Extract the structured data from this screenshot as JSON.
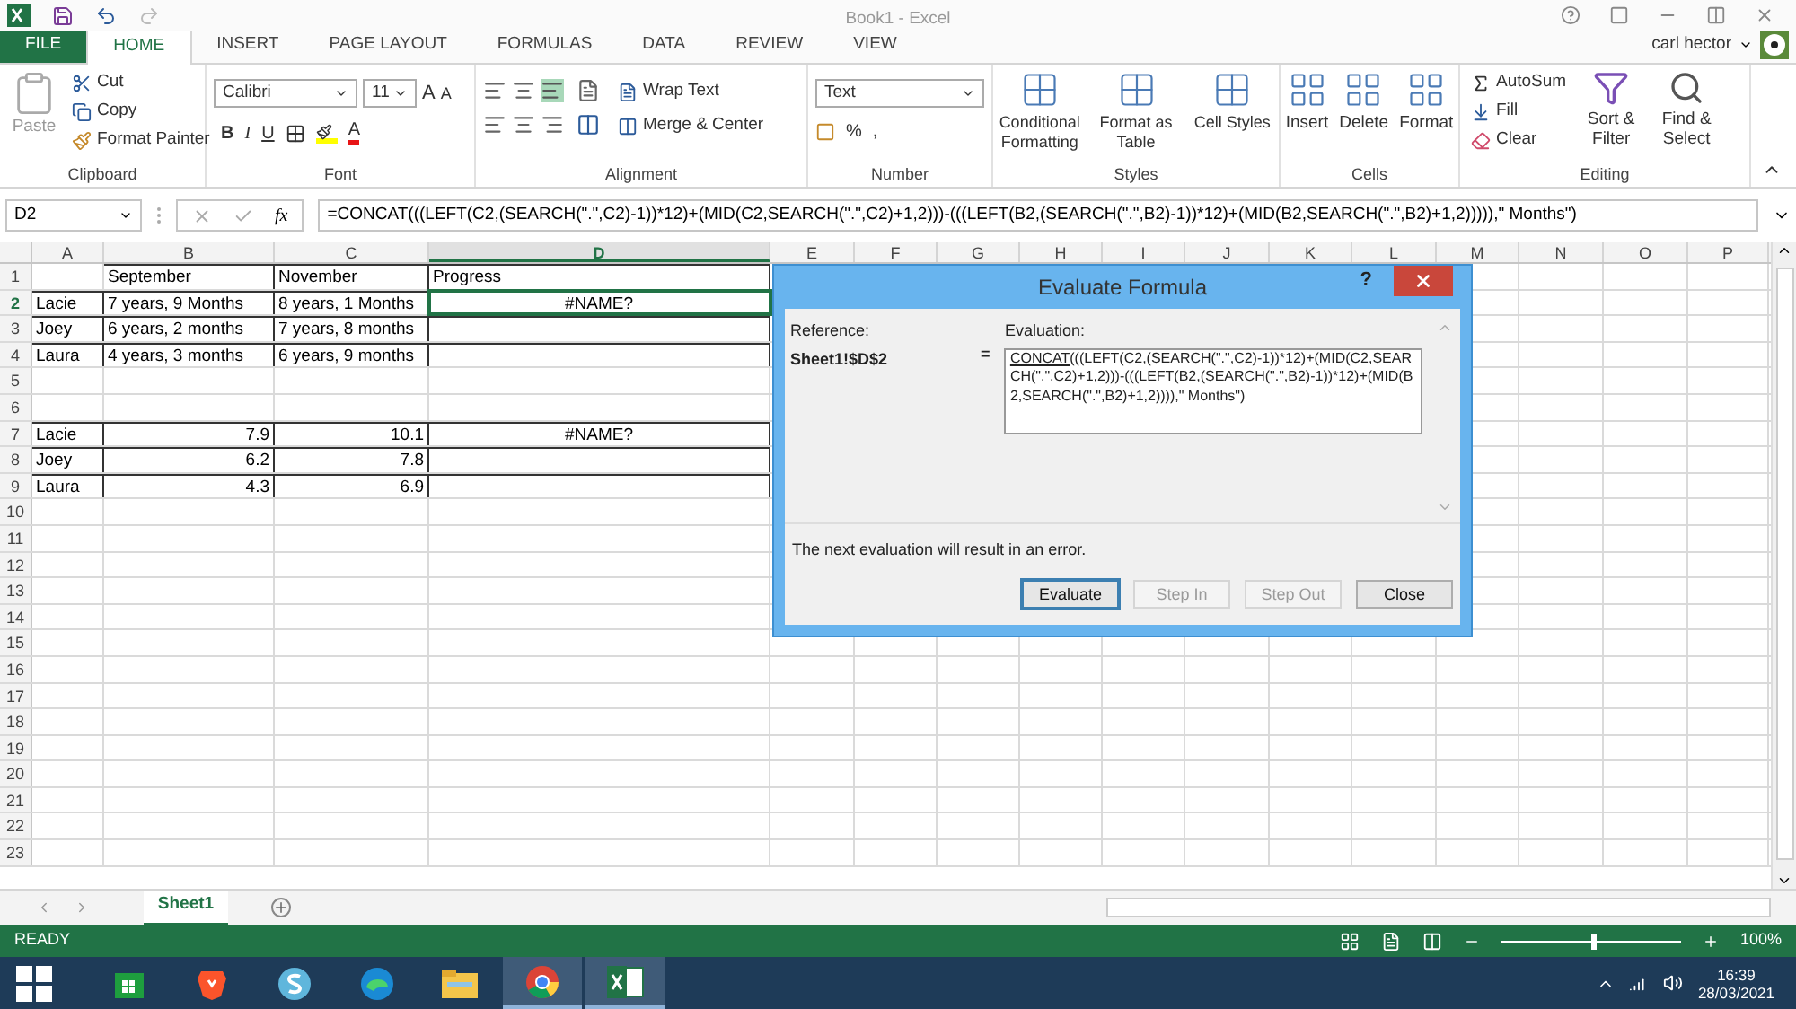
{
  "window": {
    "title": "Book1 - Excel",
    "user": "carl hector"
  },
  "ribbon_tabs": [
    {
      "label": "FILE",
      "kind": "file",
      "selected": false
    },
    {
      "label": "HOME",
      "kind": "tab",
      "selected": true
    },
    {
      "label": "INSERT",
      "kind": "tab",
      "selected": false
    },
    {
      "label": "PAGE LAYOUT",
      "kind": "tab",
      "selected": false
    },
    {
      "label": "FORMULAS",
      "kind": "tab",
      "selected": false
    },
    {
      "label": "DATA",
      "kind": "tab",
      "selected": false
    },
    {
      "label": "REVIEW",
      "kind": "tab",
      "selected": false
    },
    {
      "label": "VIEW",
      "kind": "tab",
      "selected": false
    }
  ],
  "ribbon": {
    "clipboard": {
      "label": "Clipboard",
      "paste": "Paste",
      "cut": "Cut",
      "copy": "Copy",
      "format_painter": "Format Painter"
    },
    "font": {
      "label": "Font",
      "family": "Calibri",
      "size": "11",
      "grow": "A",
      "shrink": "A",
      "bold": "B",
      "italic": "I",
      "underline": "U",
      "font_color_letter": "A"
    },
    "alignment": {
      "label": "Alignment",
      "wrap": "Wrap Text",
      "merge": "Merge & Center"
    },
    "number": {
      "label": "Number",
      "format": "Text",
      "percent": "%",
      "comma": ","
    },
    "styles": {
      "label": "Styles",
      "items": [
        "Conditional Formatting",
        "Format as Table",
        "Cell Styles"
      ]
    },
    "cells": {
      "label": "Cells",
      "items": [
        "Insert",
        "Delete",
        "Format"
      ]
    },
    "editing": {
      "label": "Editing",
      "autosum": "AutoSum",
      "fill": "Fill",
      "clear": "Clear",
      "sort": "Sort & Filter",
      "find": "Find & Select"
    }
  },
  "formula_bar": {
    "name_box": "D2",
    "fx": "fx",
    "formula": "=CONCAT(((LEFT(C2,(SEARCH(\".\",C2)-1))*12)+(MID(C2,SEARCH(\".\",C2)+1,2)))-(((LEFT(B2,(SEARCH(\".\",B2)-1))*12)+(MID(B2,SEARCH(\".\",B2)+1,2))))),\" Months\")"
  },
  "sheet": {
    "columns": [
      {
        "label": "A",
        "selected": false
      },
      {
        "label": "B",
        "selected": false
      },
      {
        "label": "C",
        "selected": false
      },
      {
        "label": "D",
        "selected": true
      },
      {
        "label": "E",
        "selected": false
      },
      {
        "label": "F",
        "selected": false
      },
      {
        "label": "G",
        "selected": false
      },
      {
        "label": "H",
        "selected": false
      },
      {
        "label": "I",
        "selected": false
      },
      {
        "label": "J",
        "selected": false
      },
      {
        "label": "K",
        "selected": false
      },
      {
        "label": "L",
        "selected": false
      },
      {
        "label": "M",
        "selected": false
      },
      {
        "label": "N",
        "selected": false
      },
      {
        "label": "O",
        "selected": false
      },
      {
        "label": "P",
        "selected": false
      }
    ],
    "rows": [
      {
        "number": "1",
        "selected": false,
        "bordered": true,
        "cells": [
          {
            "text": "",
            "kind": "text"
          },
          {
            "text": "September",
            "kind": "text"
          },
          {
            "text": "November",
            "kind": "text"
          },
          {
            "text": "Progress",
            "kind": "text"
          }
        ]
      },
      {
        "number": "2",
        "selected": true,
        "bordered": true,
        "cells": [
          {
            "text": "Lacie",
            "kind": "text"
          },
          {
            "text": "7 years, 9 Months",
            "kind": "text"
          },
          {
            "text": "8 years, 1 Months",
            "kind": "text"
          },
          {
            "text": "#NAME?",
            "kind": "error"
          }
        ]
      },
      {
        "number": "3",
        "selected": false,
        "bordered": true,
        "cells": [
          {
            "text": "Joey",
            "kind": "text"
          },
          {
            "text": "6 years, 2 months",
            "kind": "text"
          },
          {
            "text": "7 years, 8 months",
            "kind": "text"
          },
          {
            "text": "",
            "kind": "text"
          }
        ]
      },
      {
        "number": "4",
        "selected": false,
        "bordered": true,
        "cells": [
          {
            "text": "Laura",
            "kind": "text"
          },
          {
            "text": "4 years, 3 months",
            "kind": "text"
          },
          {
            "text": "6 years, 9 months",
            "kind": "text"
          },
          {
            "text": "",
            "kind": "text"
          }
        ]
      },
      {
        "number": "5",
        "selected": false,
        "bordered": false,
        "cells": []
      },
      {
        "number": "6",
        "selected": false,
        "bordered": false,
        "cells": []
      },
      {
        "number": "7",
        "selected": false,
        "bordered": true,
        "cells": [
          {
            "text": "Lacie",
            "kind": "text"
          },
          {
            "text": "7.9",
            "kind": "number"
          },
          {
            "text": "10.1",
            "kind": "number"
          },
          {
            "text": "#NAME?",
            "kind": "error"
          }
        ]
      },
      {
        "number": "8",
        "selected": false,
        "bordered": true,
        "cells": [
          {
            "text": "Joey",
            "kind": "text"
          },
          {
            "text": "6.2",
            "kind": "number"
          },
          {
            "text": "7.8",
            "kind": "number"
          },
          {
            "text": "",
            "kind": "text"
          }
        ]
      },
      {
        "number": "9",
        "selected": false,
        "bordered": true,
        "cells": [
          {
            "text": "Laura",
            "kind": "text"
          },
          {
            "text": "4.3",
            "kind": "number"
          },
          {
            "text": "6.9",
            "kind": "number"
          },
          {
            "text": "",
            "kind": "text"
          }
        ]
      },
      {
        "number": "10",
        "selected": false,
        "bordered": false,
        "cells": []
      },
      {
        "number": "11",
        "selected": false,
        "bordered": false,
        "cells": []
      },
      {
        "number": "12",
        "selected": false,
        "bordered": false,
        "cells": []
      },
      {
        "number": "13",
        "selected": false,
        "bordered": false,
        "cells": []
      },
      {
        "number": "14",
        "selected": false,
        "bordered": false,
        "cells": []
      },
      {
        "number": "15",
        "selected": false,
        "bordered": false,
        "cells": []
      },
      {
        "number": "16",
        "selected": false,
        "bordered": false,
        "cells": []
      },
      {
        "number": "17",
        "selected": false,
        "bordered": false,
        "cells": []
      },
      {
        "number": "18",
        "selected": false,
        "bordered": false,
        "cells": []
      },
      {
        "number": "19",
        "selected": false,
        "bordered": false,
        "cells": []
      },
      {
        "number": "20",
        "selected": false,
        "bordered": false,
        "cells": []
      },
      {
        "number": "21",
        "selected": false,
        "bordered": false,
        "cells": []
      },
      {
        "number": "22",
        "selected": false,
        "bordered": false,
        "cells": []
      },
      {
        "number": "23",
        "selected": false,
        "bordered": false,
        "cells": []
      }
    ]
  },
  "dialog": {
    "title": "Evaluate Formula",
    "help": "?",
    "reference_label": "Reference:",
    "reference": "Sheet1!$D$2",
    "equals": "=",
    "evaluation_label": "Evaluation:",
    "evaluation_underlined": "CONCAT",
    "evaluation_rest": "(((LEFT(C2,(SEARCH(\".\",C2)-1))*12)+(MID(C2,SEARCH(\".\",C2)+1,2)))-(((LEFT(B2,(SEARCH(\".\",B2)-1))*12)+(MID(B2,SEARCH(\".\",B2)+1,2)))),\" Months\")",
    "message": "The next evaluation will result in an error.",
    "buttons": [
      {
        "label": "Evaluate",
        "disabled": false,
        "default": true
      },
      {
        "label": "Step In",
        "disabled": true,
        "default": false
      },
      {
        "label": "Step Out",
        "disabled": true,
        "default": false
      },
      {
        "label": "Close",
        "disabled": false,
        "default": false
      }
    ]
  },
  "sheet_tabs": [
    {
      "label": "Sheet1",
      "selected": true
    }
  ],
  "status_bar": {
    "mode": "READY",
    "zoom": "100%",
    "level": 0.5
  },
  "taskbar": {
    "apps": [
      {
        "kind": "store",
        "selected": false
      },
      {
        "kind": "brave",
        "selected": false
      },
      {
        "kind": "s",
        "selected": false
      },
      {
        "kind": "edge",
        "selected": false
      },
      {
        "kind": "explorer",
        "selected": false
      },
      {
        "kind": "chrome",
        "selected": true
      },
      {
        "kind": "excel",
        "selected": true
      }
    ],
    "time": "16:39",
    "date": "28/03/2021"
  }
}
